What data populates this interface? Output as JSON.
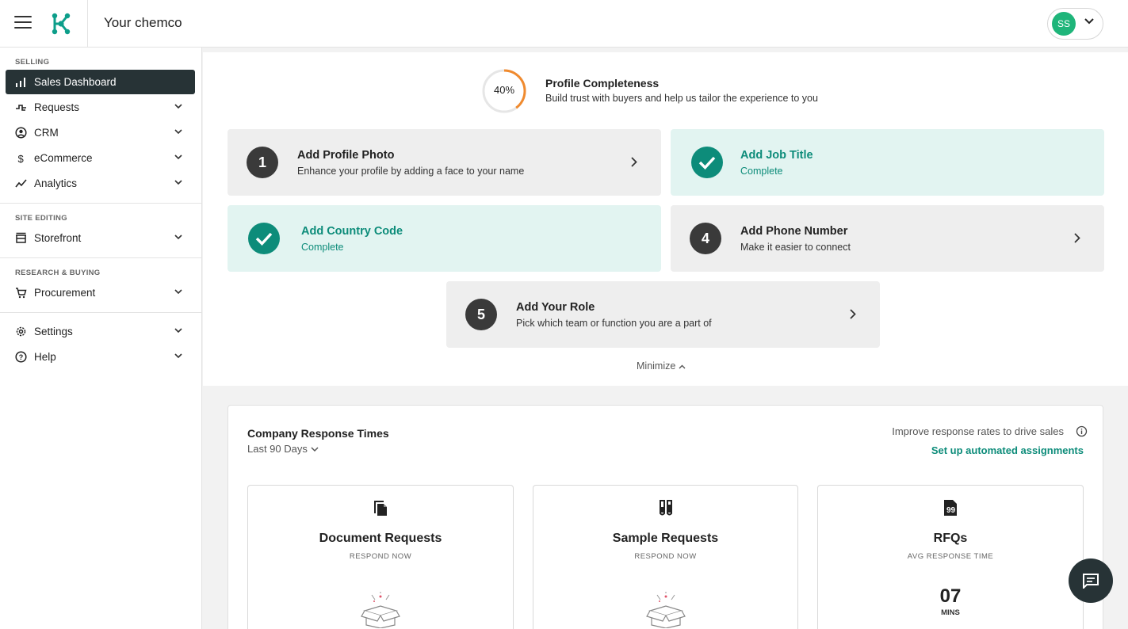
{
  "header": {
    "app_title": "Your chemco",
    "user_initials": "SS",
    "avatar_color": "#1fb57a"
  },
  "sidebar": {
    "sections": {
      "selling": "SELLING",
      "site_editing": "SITE EDITING",
      "research": "RESEARCH & BUYING"
    },
    "items": [
      {
        "label": "Sales Dashboard",
        "icon": "bar-chart-icon",
        "active": true
      },
      {
        "label": "Requests",
        "icon": "requests-icon"
      },
      {
        "label": "CRM",
        "icon": "user-circle-icon"
      },
      {
        "label": "eCommerce",
        "icon": "dollar-icon"
      },
      {
        "label": "Analytics",
        "icon": "trend-icon"
      },
      {
        "label": "Storefront",
        "icon": "storefront-icon"
      },
      {
        "label": "Procurement",
        "icon": "cart-icon"
      },
      {
        "label": "Settings",
        "icon": "gear-icon"
      },
      {
        "label": "Help",
        "icon": "help-icon"
      }
    ]
  },
  "profile": {
    "percent_label": "40%",
    "percent": 40,
    "title": "Profile Completeness",
    "subtitle": "Build trust with buyers and help us tailor the experience to you",
    "tasks": [
      {
        "num": "1",
        "title": "Add Profile Photo",
        "sub": "Enhance your profile by adding a face to your name",
        "complete": false
      },
      {
        "num": "",
        "title": "Add Job Title",
        "sub": "Complete",
        "complete": true
      },
      {
        "num": "",
        "title": "Add Country Code",
        "sub": "Complete",
        "complete": true
      },
      {
        "num": "4",
        "title": "Add Phone Number",
        "sub": "Make it easier to connect",
        "complete": false
      },
      {
        "num": "5",
        "title": "Add Your Role",
        "sub": "Pick which team or function you are a part of",
        "complete": false
      }
    ],
    "minimize_label": "Minimize"
  },
  "response": {
    "title": "Company Response Times",
    "range": "Last 90 Days",
    "hint": "Improve response rates to drive sales",
    "link": "Set up automated assignments",
    "metrics": [
      {
        "title": "Document Requests",
        "sub": "RESPOND NOW",
        "icon": "document-copy-icon"
      },
      {
        "title": "Sample Requests",
        "sub": "RESPOND NOW",
        "icon": "test-tubes-icon"
      },
      {
        "title": "RFQs",
        "sub": "AVG RESPONSE TIME",
        "icon": "quote-file-icon",
        "value": "07",
        "unit": "MINS"
      }
    ]
  },
  "colors": {
    "accent": "#0d8c7a",
    "active_nav": "#273336",
    "ring_progress": "#f08a2e"
  }
}
